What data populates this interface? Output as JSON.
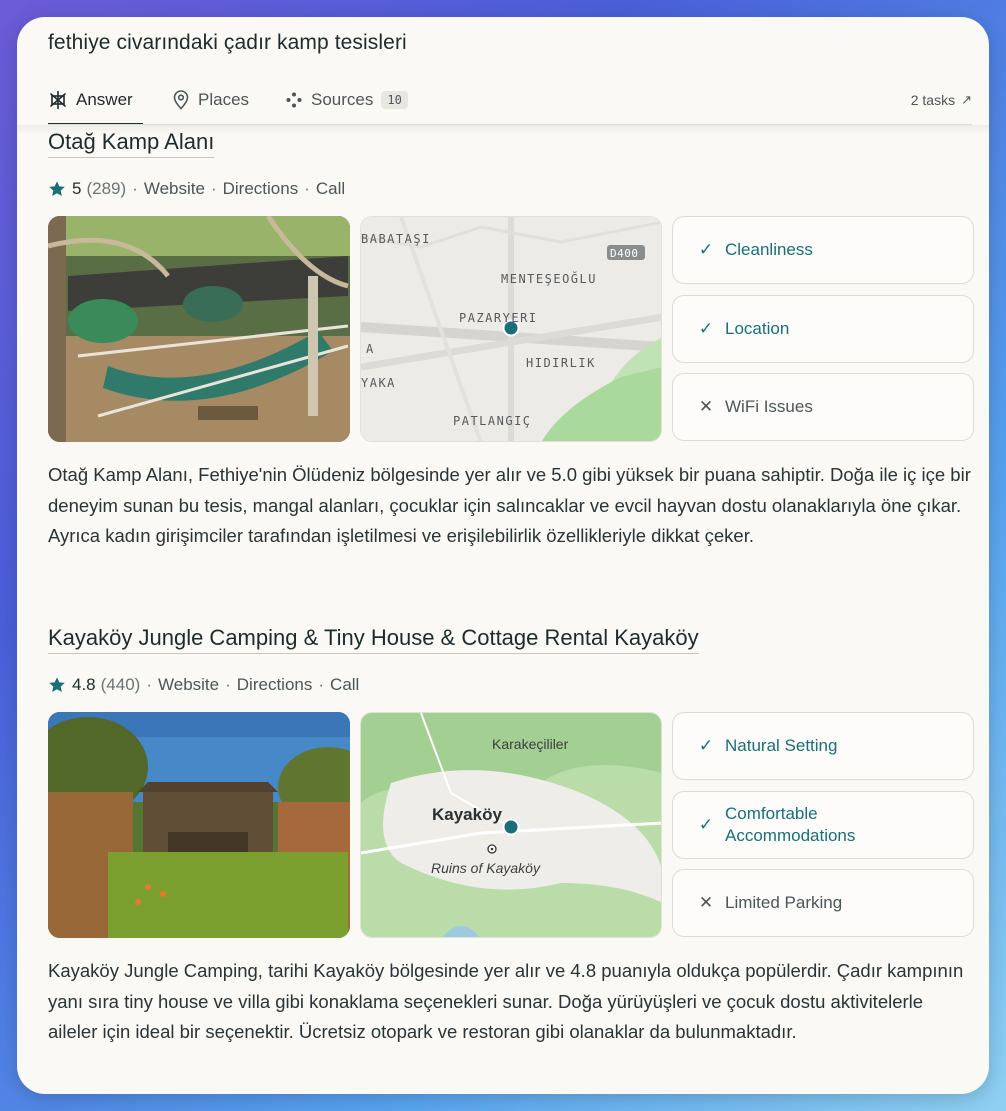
{
  "query": "fethiye civarındaki çadır kamp tesisleri",
  "tabs": [
    {
      "label": "Answer"
    },
    {
      "label": "Places"
    },
    {
      "label": "Sources",
      "badge": "10"
    }
  ],
  "tasks": {
    "label": "2 tasks",
    "arrow": "↗"
  },
  "accent_color": "#1b6e78",
  "places": [
    {
      "title": "Otağ Kamp Alanı",
      "rating": "5",
      "reviews": "(289)",
      "links": [
        "Website",
        "Directions",
        "Call"
      ],
      "map_labels": [
        "BABATAŞI",
        "D400",
        "MENTEŞEOĞLU",
        "PAZARYERI",
        "HIDIRLIK",
        "YAKA",
        "PATLANGIÇ",
        "A"
      ],
      "features": [
        {
          "label": "Cleanliness",
          "type": "positive",
          "icon": "check-icon"
        },
        {
          "label": "Location",
          "type": "positive",
          "icon": "check-icon"
        },
        {
          "label": "WiFi Issues",
          "type": "negative",
          "icon": "x-icon"
        }
      ],
      "description": "Otağ Kamp Alanı, Fethiye'nin Ölüdeniz bölgesinde yer alır ve 5.0 gibi yüksek bir puana sahiptir. Doğa ile iç içe bir deneyim sunan bu tesis, mangal alanları, çocuklar için salıncaklar ve evcil hayvan dostu olanaklarıyla öne çıkar. Ayrıca kadın girişimciler tarafından işletilmesi ve erişilebilirlik özellikleriyle dikkat çeker."
    },
    {
      "title": "Kayaköy Jungle Camping & Tiny House & Cottage Rental Kayaköy",
      "rating": "4.8",
      "reviews": "(440)",
      "links": [
        "Website",
        "Directions",
        "Call"
      ],
      "map_labels": [
        "Karakeçililer",
        "Kayaköy",
        "Ruins of Kayaköy"
      ],
      "features": [
        {
          "label": "Natural Setting",
          "type": "positive",
          "icon": "check-icon"
        },
        {
          "label": "Comfortable Accommodations",
          "type": "positive",
          "icon": "check-icon"
        },
        {
          "label": "Limited Parking",
          "type": "negative",
          "icon": "x-icon"
        }
      ],
      "description": "Kayaköy Jungle Camping, tarihi Kayaköy bölgesinde yer alır ve 4.8 puanıyla oldukça popülerdir. Çadır kampının yanı sıra tiny house ve villa gibi konaklama seçenekleri sunar. Doğa yürüyüşleri ve çocuk dostu aktivitelerle aileler için ideal bir seçenektir. Ücretsiz otopark ve restoran gibi olanaklar da bulunmaktadır."
    }
  ]
}
